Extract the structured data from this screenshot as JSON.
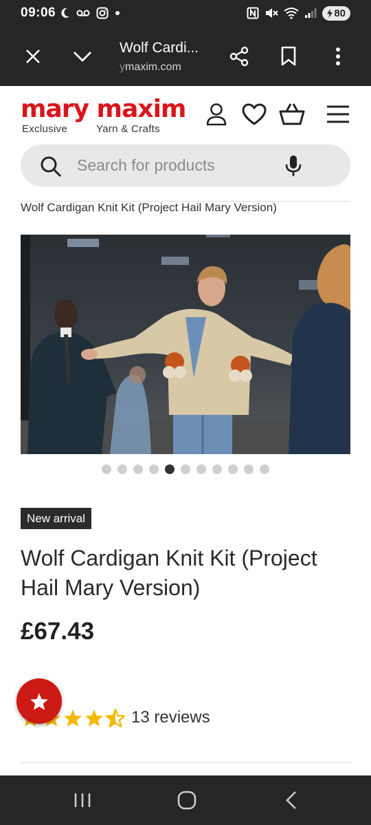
{
  "status_bar": {
    "time": "09:06",
    "battery": "80"
  },
  "browser": {
    "tab_title": "Wolf Cardi...",
    "url_prefix": "y",
    "url": "maxim.com"
  },
  "site": {
    "logo_text": "mary maxim",
    "logo_left_sub": "Exclusive",
    "logo_right_sub": "Yarn & Crafts",
    "brand_color": "#d9151c"
  },
  "search": {
    "placeholder": "Search for products"
  },
  "breadcrumb": "Wolf Cardigan Knit Kit (Project Hail Mary Version)",
  "product": {
    "image_count": 11,
    "active_image_index": 4,
    "badge": "New arrival",
    "title": "Wolf Cardigan Knit Kit (Project Hail Mary Version)",
    "price": "£67.43",
    "rating": 4.5,
    "reviews": "13 reviews"
  },
  "icons": [
    "close-icon",
    "chevron-down-icon",
    "share-icon",
    "bookmark-icon",
    "more-vert-icon",
    "account-icon",
    "heart-icon",
    "basket-icon",
    "menu-icon",
    "search-icon",
    "mic-icon",
    "star-icon",
    "recents-icon",
    "home-icon",
    "back-icon"
  ]
}
